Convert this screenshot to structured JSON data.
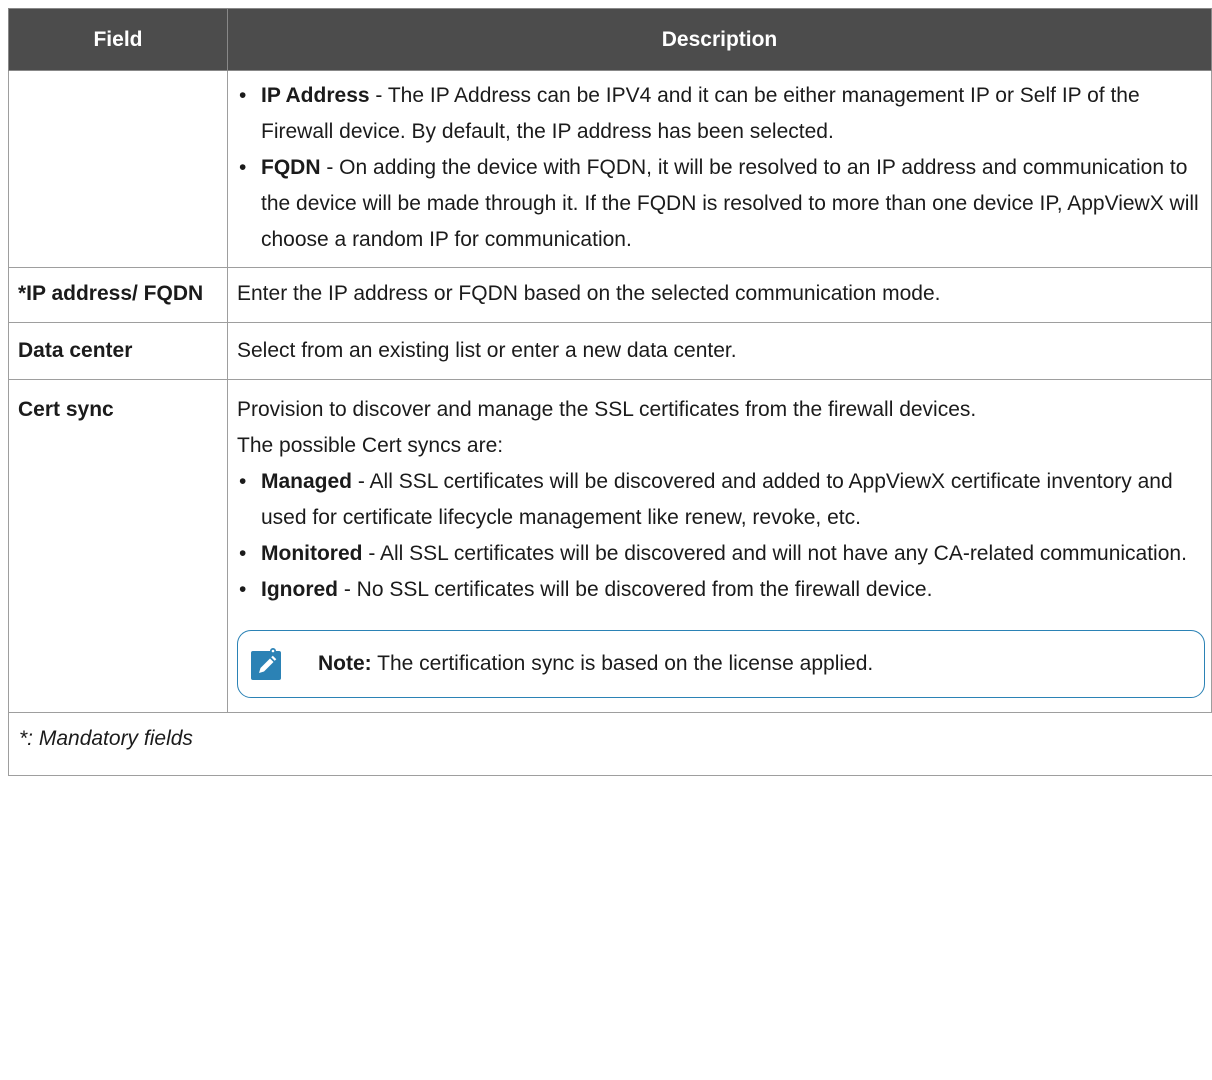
{
  "header": {
    "col1": "Field",
    "col2": "Description"
  },
  "row1": {
    "bullets": [
      {
        "label": "IP Address",
        "text": " - The IP Address can be IPV4 and it can be either management IP or Self IP of the Firewall device. By default, the IP address has been selected."
      },
      {
        "label": "FQDN",
        "text": " - On adding the device with FQDN, it will be resolved to an IP address and communication to the device will be made through it. If the FQDN is resolved to more than one device IP, AppViewX will choose a random IP for communication."
      }
    ]
  },
  "row2": {
    "field": "*IP address/ FQDN",
    "desc": "Enter the IP address or FQDN based on the selected communication mode."
  },
  "row3": {
    "field": "Data center",
    "desc": "Select from an existing list or enter a new data center."
  },
  "row4": {
    "field": "Cert sync",
    "desc_line1": "Provision to discover and manage the SSL certificates from the firewall devices.",
    "desc_line2": "The possible Cert syncs are:",
    "bullets": [
      {
        "label": "Managed",
        "text": " - All SSL certificates will be discovered and added to AppViewX certificate inventory and used for certificate lifecycle management like renew, revoke, etc."
      },
      {
        "label": "Monitored",
        "text": " - All SSL certificates will be discovered and will not have any CA-related communication."
      },
      {
        "label": "Ignored",
        "text": " - No SSL certificates will be discovered from the firewall device."
      }
    ],
    "note": {
      "icon": "pencil-note-icon",
      "label": "Note:",
      "text": " The certification sync is based on the license applied."
    }
  },
  "footer": "*: Mandatory fields",
  "colors": {
    "header_bg": "#4c4c4c",
    "note_accent": "#2b82b5"
  }
}
